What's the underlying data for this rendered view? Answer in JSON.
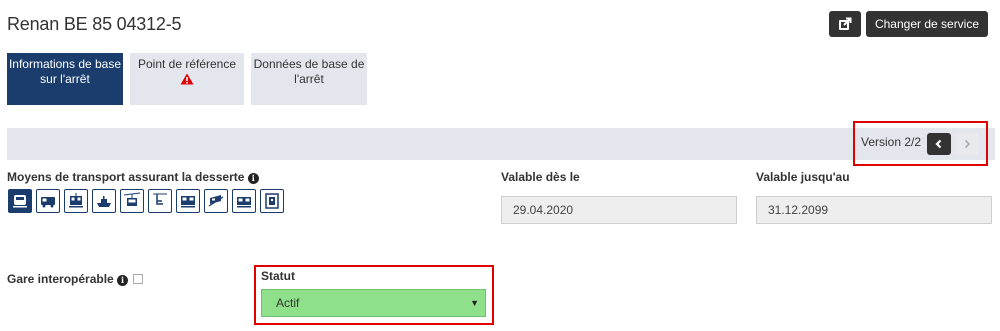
{
  "header": {
    "title": "Renan BE 85 04312-5",
    "change_service_label": "Changer de service"
  },
  "tabs": [
    {
      "line1": "Informations de base",
      "line2": "sur l'arrêt"
    },
    {
      "line1": "Point de référence",
      "line2": ""
    },
    {
      "line1": "Données de base de",
      "line2": "l'arrêt"
    }
  ],
  "version": {
    "label": "Version 2/2",
    "prev": "‹",
    "next": "›"
  },
  "transport": {
    "label": "Moyens de transport assurant la desserte",
    "selected": "train",
    "icons": [
      "train-icon",
      "bus-icon",
      "tram-icon",
      "boat-icon",
      "cable-car-icon",
      "chairlift-icon",
      "rack-railway-icon",
      "funicular-icon",
      "metro-icon",
      "elevator-icon"
    ]
  },
  "validity": {
    "from_label": "Valable dès le",
    "from_value": "29.04.2020",
    "to_label": "Valable jusqu'au",
    "to_value": "31.12.2099"
  },
  "interop": {
    "label": "Gare interopérable"
  },
  "status": {
    "label": "Statut",
    "value": "Actif",
    "color": "#8fe08a"
  },
  "colors": {
    "primary": "#1b3d6e",
    "highlight_border": "#e00000",
    "warning": "#e00000"
  }
}
